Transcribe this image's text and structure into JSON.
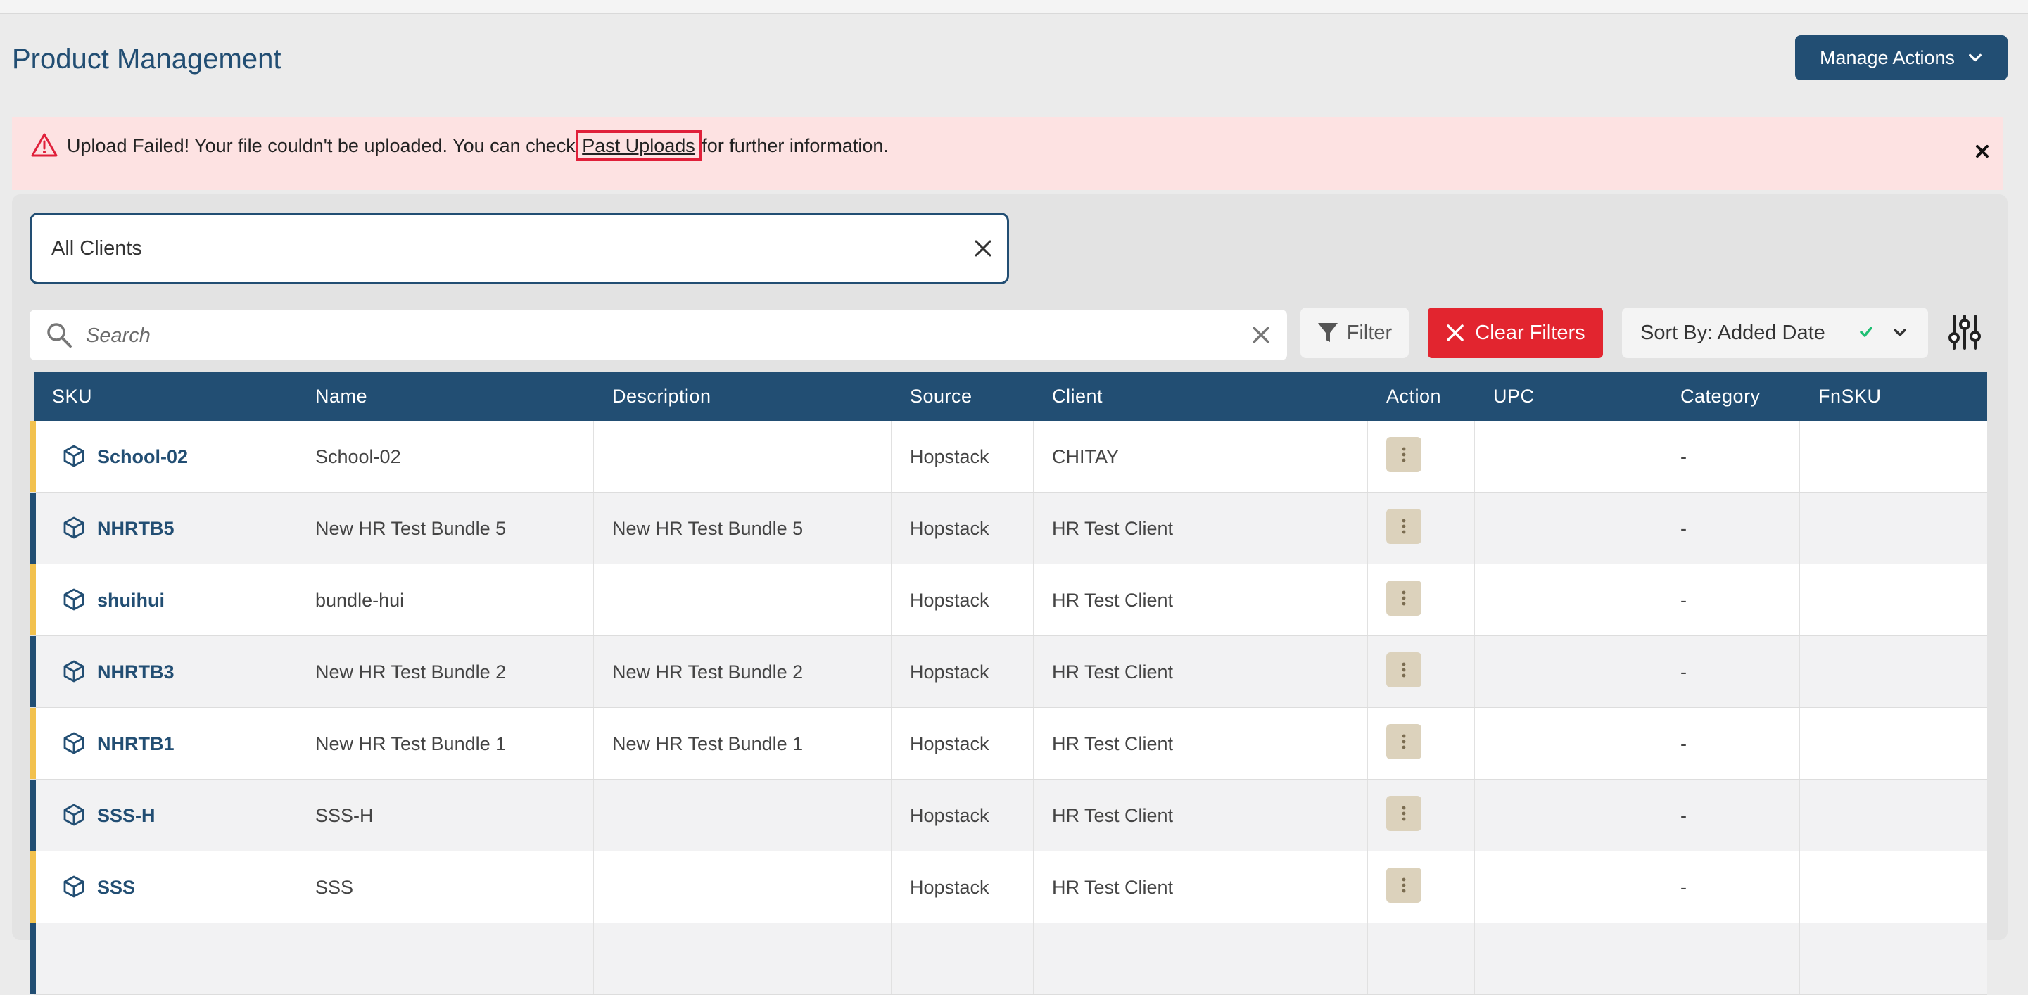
{
  "page": {
    "title": "Product Management"
  },
  "header": {
    "manage_actions": "Manage Actions"
  },
  "alert": {
    "prefix": "Upload Failed! Your file couldn't be uploaded. You can check ",
    "link": "Past Uploads",
    "suffix": " for further information.",
    "bg_color": "#fde2e2"
  },
  "client_filter": {
    "value": "All Clients"
  },
  "search": {
    "placeholder": "Search"
  },
  "toolbar": {
    "filter_label": "Filter",
    "clear_filters_label": "Clear Filters",
    "sort_label": "Sort By: Added Date"
  },
  "table": {
    "headers": [
      "SKU",
      "Name",
      "Description",
      "Source",
      "Client",
      "Action",
      "UPC",
      "Category",
      "FnSKU"
    ],
    "rows": [
      {
        "sku": "School-02",
        "name": "School-02",
        "description": "",
        "source": "Hopstack",
        "client": "CHITAY",
        "upc": "",
        "category": "-",
        "fnsku": "",
        "stripe": "#f2c14e"
      },
      {
        "sku": "NHRTB5",
        "name": "New HR Test Bundle 5",
        "description": "New HR Test Bundle 5",
        "source": "Hopstack",
        "client": "HR Test Client",
        "upc": "",
        "category": "-",
        "fnsku": "",
        "stripe": "#224e73"
      },
      {
        "sku": "shuihui",
        "name": "bundle-hui",
        "description": "",
        "source": "Hopstack",
        "client": "HR Test Client",
        "upc": "",
        "category": "-",
        "fnsku": "",
        "stripe": "#f2c14e"
      },
      {
        "sku": "NHRTB3",
        "name": "New HR Test Bundle 2",
        "description": "New HR Test Bundle 2",
        "source": "Hopstack",
        "client": "HR Test Client",
        "upc": "",
        "category": "-",
        "fnsku": "",
        "stripe": "#224e73"
      },
      {
        "sku": "NHRTB1",
        "name": "New HR Test Bundle 1",
        "description": "New HR Test Bundle 1",
        "source": "Hopstack",
        "client": "HR Test Client",
        "upc": "",
        "category": "-",
        "fnsku": "",
        "stripe": "#f2c14e"
      },
      {
        "sku": "SSS-H",
        "name": "SSS-H",
        "description": "",
        "source": "Hopstack",
        "client": "HR Test Client",
        "upc": "",
        "category": "-",
        "fnsku": "",
        "stripe": "#224e73"
      },
      {
        "sku": "SSS",
        "name": "SSS",
        "description": "",
        "source": "Hopstack",
        "client": "HR Test Client",
        "upc": "",
        "category": "-",
        "fnsku": "",
        "stripe": "#f2c14e"
      },
      {
        "sku": "",
        "name": "",
        "description": "",
        "source": "",
        "client": "",
        "upc": "",
        "category": "",
        "fnsku": "",
        "stripe": "#224e73"
      }
    ]
  },
  "colors": {
    "primary": "#224e73",
    "danger": "#e2252f",
    "accent_yellow": "#f2c14e",
    "check_green": "#1fbf73"
  }
}
